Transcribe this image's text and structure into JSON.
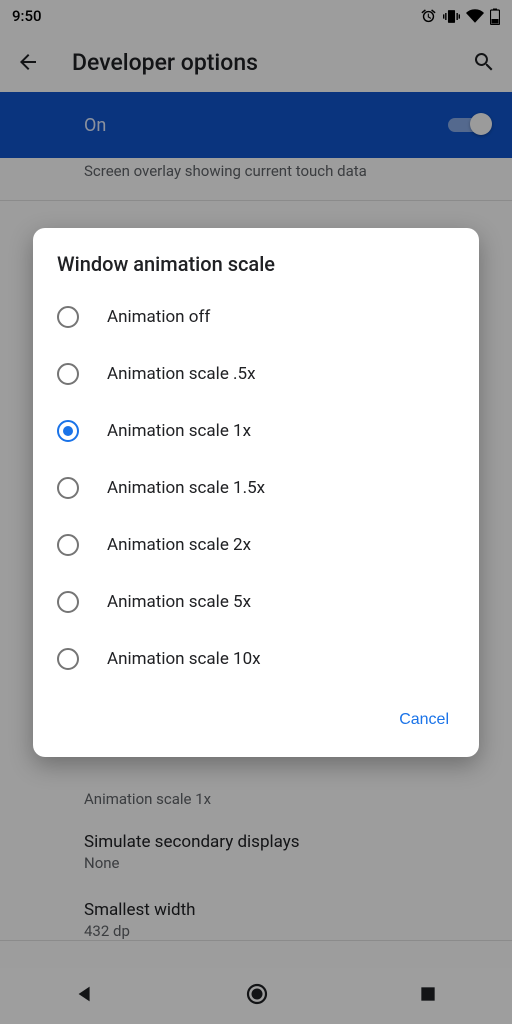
{
  "status": {
    "time": "9:50"
  },
  "header": {
    "title": "Developer options"
  },
  "on_bar": {
    "label": "On"
  },
  "bg": {
    "touch_sub": "Screen overlay showing current touch data",
    "anim_sub": "Animation scale 1x",
    "sim_title": "Simulate secondary displays",
    "sim_sub": "None",
    "sw_title": "Smallest width",
    "sw_sub": "432 dp"
  },
  "dialog": {
    "title": "Window animation scale",
    "options": [
      "Animation off",
      "Animation scale .5x",
      "Animation scale 1x",
      "Animation scale 1.5x",
      "Animation scale 2x",
      "Animation scale 5x",
      "Animation scale 10x"
    ],
    "selected_index": 2,
    "cancel": "Cancel"
  }
}
